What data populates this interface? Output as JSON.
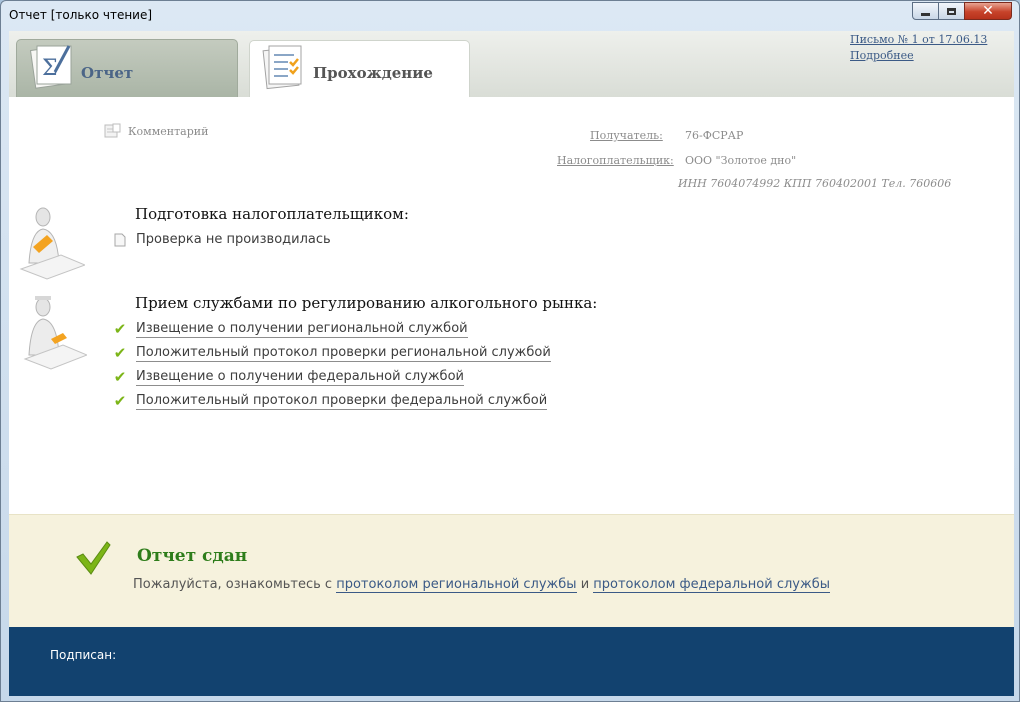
{
  "window": {
    "title": "Отчет [только чтение]"
  },
  "tabs": [
    {
      "label": "Отчет",
      "icon": "sigma-document-icon"
    },
    {
      "label": "Прохождение",
      "icon": "checklist-document-icon"
    }
  ],
  "header": {
    "letter_link": "Письмо № 1 от 17.06.13",
    "details_link": "Подробнее",
    "comment": "Комментарий"
  },
  "meta": {
    "recipient_label": "Получатель:",
    "recipient_value": "76-ФСРАР",
    "taxpayer_label": "Налогоплательщик:",
    "taxpayer_value": "ООО \"Золотое дно\"",
    "inn_line": "ИНН 7604074992 КПП 760402001 Тел. 760606"
  },
  "sections": [
    {
      "title": "Подготовка налогоплательщиком:",
      "items": [
        {
          "text": "Проверка не производилась",
          "status": "none"
        }
      ]
    },
    {
      "title": "Прием службами по регулированию алкогольного рынка:",
      "items": [
        {
          "text": "Извещение о получении региональной службой",
          "status": "ok"
        },
        {
          "text": "Положительный протокол проверки региональной службой",
          "status": "ok"
        },
        {
          "text": "Извещение о получении федеральной службой",
          "status": "ok"
        },
        {
          "text": "Положительный протокол проверки федеральной службой",
          "status": "ok"
        }
      ]
    }
  ],
  "status": {
    "title": "Отчет сдан",
    "prefix": "Пожалуйста, ознакомьтесь с ",
    "link1": "протоколом региональной службы",
    "connector": " и ",
    "link2": "протоколом федеральной службы"
  },
  "footer": {
    "signed_label": "Подписан:"
  },
  "colors": {
    "accent_green": "#2e7d1b",
    "check_green": "#7cb518",
    "footer_blue": "#12426f",
    "link_blue": "#3b5a86"
  }
}
